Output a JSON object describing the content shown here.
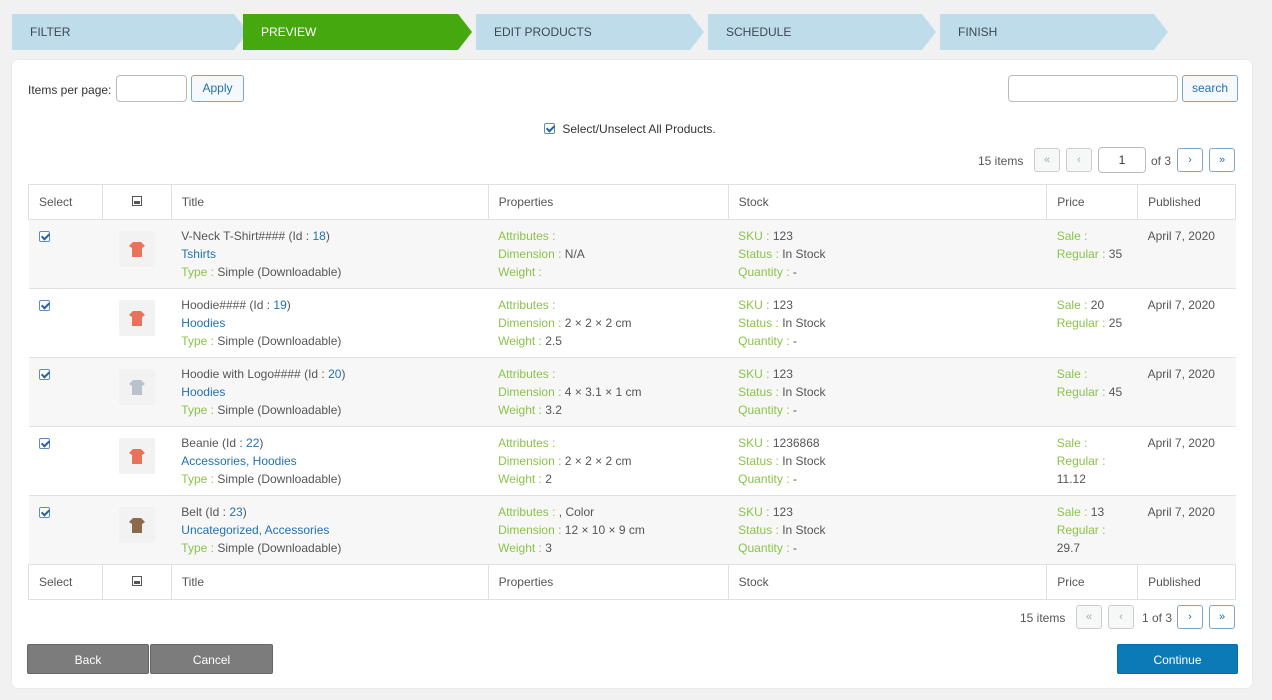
{
  "steps": [
    "FILTER",
    "PREVIEW",
    "EDIT PRODUCTS",
    "SCHEDULE",
    "FINISH"
  ],
  "controls": {
    "items_per_page_label": "Items per page:",
    "apply_label": "Apply",
    "search_label": "search",
    "select_all_label": "Select/Unselect All Products."
  },
  "pagination_top": {
    "items": "15 items",
    "page": "1",
    "of": "of 3"
  },
  "pagination_bottom": {
    "items": "15 items",
    "text": "1 of 3"
  },
  "columns": [
    "Select",
    "",
    "Title",
    "Properties",
    "Stock",
    "Price",
    "Published"
  ],
  "labels": {
    "attributes": "Attributes :",
    "dimension": "Dimension :",
    "weight": "Weight :",
    "sku": "SKU :",
    "status": "Status :",
    "quantity": "Quantity :",
    "sale": "Sale :",
    "regular": "Regular :",
    "type": "Type :",
    "id_prefix": "(Id : ",
    "id_suffix": ")"
  },
  "rows": [
    {
      "title": "V-Neck T-Shirt####",
      "id": "18",
      "categories": "Tshirts",
      "type": " Simple (Downloadable)",
      "attributes": "",
      "dimension": " N/A",
      "weight": "",
      "sku": " 123",
      "status": " In Stock",
      "quantity": " -",
      "sale": "",
      "regular": " 35",
      "published": "April 7, 2020",
      "thumb_color": "#e8735a"
    },
    {
      "title": "Hoodie####",
      "id": "19",
      "categories": "Hoodies",
      "type": " Simple (Downloadable)",
      "attributes": "",
      "dimension": " 2 × 2 × 2 cm",
      "weight": " 2.5",
      "sku": " 123",
      "status": " In Stock",
      "quantity": " -",
      "sale": " 20",
      "regular": " 25",
      "published": "April 7, 2020",
      "thumb_color": "#e8735a"
    },
    {
      "title": "Hoodie with Logo####",
      "id": "20",
      "categories": "Hoodies",
      "type": " Simple (Downloadable)",
      "attributes": "",
      "dimension": " 4 × 3.1 × 1 cm",
      "weight": " 3.2",
      "sku": " 123",
      "status": " In Stock",
      "quantity": " -",
      "sale": "",
      "regular": " 45",
      "published": "April 7, 2020",
      "thumb_color": "#b9c3cc"
    },
    {
      "title": "Beanie",
      "id": "22",
      "categories": "Accessories, Hoodies",
      "type": " Simple (Downloadable)",
      "attributes": "",
      "dimension": " 2 × 2 × 2 cm",
      "weight": " 2",
      "sku": " 1236868",
      "status": " In Stock",
      "quantity": " -",
      "sale": "",
      "regular": " 11.12",
      "published": "April 7, 2020",
      "thumb_color": "#e8735a"
    },
    {
      "title": "Belt",
      "id": "23",
      "categories": "Uncategorized, Accessories",
      "type": " Simple (Downloadable)",
      "attributes": " , Color",
      "dimension": " 12 × 10 × 9 cm",
      "weight": " 3",
      "sku": " 123",
      "status": " In Stock",
      "quantity": " -",
      "sale": " 13",
      "regular": " 29.7",
      "published": "April 7, 2020",
      "thumb_color": "#8a6a4a"
    }
  ],
  "footer": {
    "back": "Back",
    "cancel": "Cancel",
    "continue": "Continue"
  }
}
